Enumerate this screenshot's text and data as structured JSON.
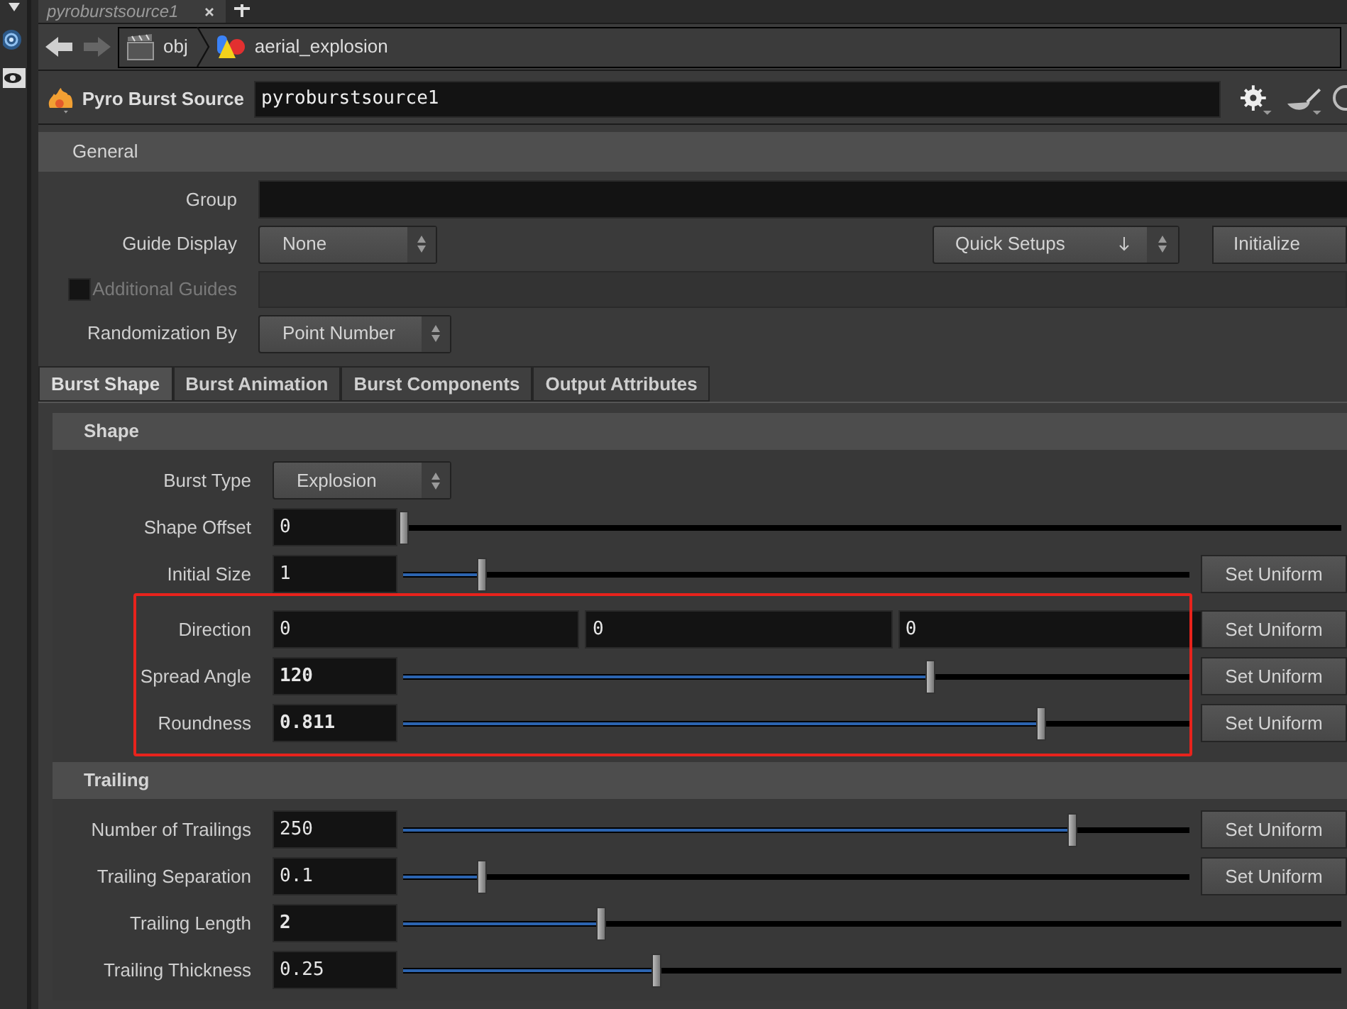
{
  "pane_tabs": [
    {
      "label": "pyroburstsource1",
      "selected": true
    }
  ],
  "path": [
    "obj",
    "aerial_explosion"
  ],
  "node": {
    "type": "Pyro Burst Source",
    "name": "pyroburstsource1"
  },
  "general": {
    "title": "General",
    "rows": [
      {
        "kind": "text",
        "label": "Group"
      },
      {
        "kind": "menu",
        "label": "Guide Display",
        "value": "None",
        "quick_setups": "Quick Setups",
        "action": "Initialize"
      },
      {
        "kind": "toggle_field",
        "label": "Additional Guides",
        "checked": false,
        "disabled": true
      },
      {
        "kind": "menu",
        "label": "Randomization By",
        "value": "Point Number"
      }
    ]
  },
  "folder_tabs": [
    {
      "label": "Burst Shape",
      "selected": true
    },
    {
      "label": "Burst Animation",
      "selected": false
    },
    {
      "label": "Burst Components",
      "selected": false
    },
    {
      "label": "Output Attributes",
      "selected": false
    }
  ],
  "sections": [
    {
      "title": "Shape",
      "params": [
        {
          "kind": "menu",
          "label": "Burst Type",
          "value": "Explosion",
          "highlighted": false
        },
        {
          "kind": "slider",
          "label": "Shape Offset",
          "value": "0",
          "changed": false,
          "level": 0.0,
          "highlighted": false
        },
        {
          "kind": "slider",
          "label": "Initial Size",
          "value": "1",
          "changed": false,
          "level": 0.1,
          "set_uniform": "Set Uniform",
          "highlighted": false
        },
        {
          "kind": "vector",
          "label": "Direction",
          "values": [
            "0",
            "0",
            "0"
          ],
          "set_uniform": "Set Uniform",
          "highlighted": true
        },
        {
          "kind": "slider",
          "label": "Spread Angle",
          "value": "120",
          "changed": true,
          "level": 0.67,
          "set_uniform": "Set Uniform",
          "highlighted": true
        },
        {
          "kind": "slider",
          "label": "Roundness",
          "value": "0.811",
          "changed": true,
          "level": 0.81,
          "set_uniform": "Set Uniform",
          "highlighted": true
        }
      ]
    },
    {
      "title": "Trailing",
      "params": [
        {
          "kind": "slider",
          "label": "Number of Trailings",
          "value": "250",
          "changed": false,
          "level": 0.85,
          "set_uniform": "Set Uniform",
          "highlighted": false
        },
        {
          "kind": "slider",
          "label": "Trailing Separation",
          "value": "0.1",
          "changed": false,
          "level": 0.1,
          "set_uniform": "Set Uniform",
          "highlighted": false
        },
        {
          "kind": "slider",
          "label": "Trailing Length",
          "value": "2",
          "changed": true,
          "level": 0.21,
          "highlighted": false
        },
        {
          "kind": "slider",
          "label": "Trailing Thickness",
          "value": "0.25",
          "changed": false,
          "level": 0.27,
          "highlighted": false
        }
      ]
    }
  ]
}
